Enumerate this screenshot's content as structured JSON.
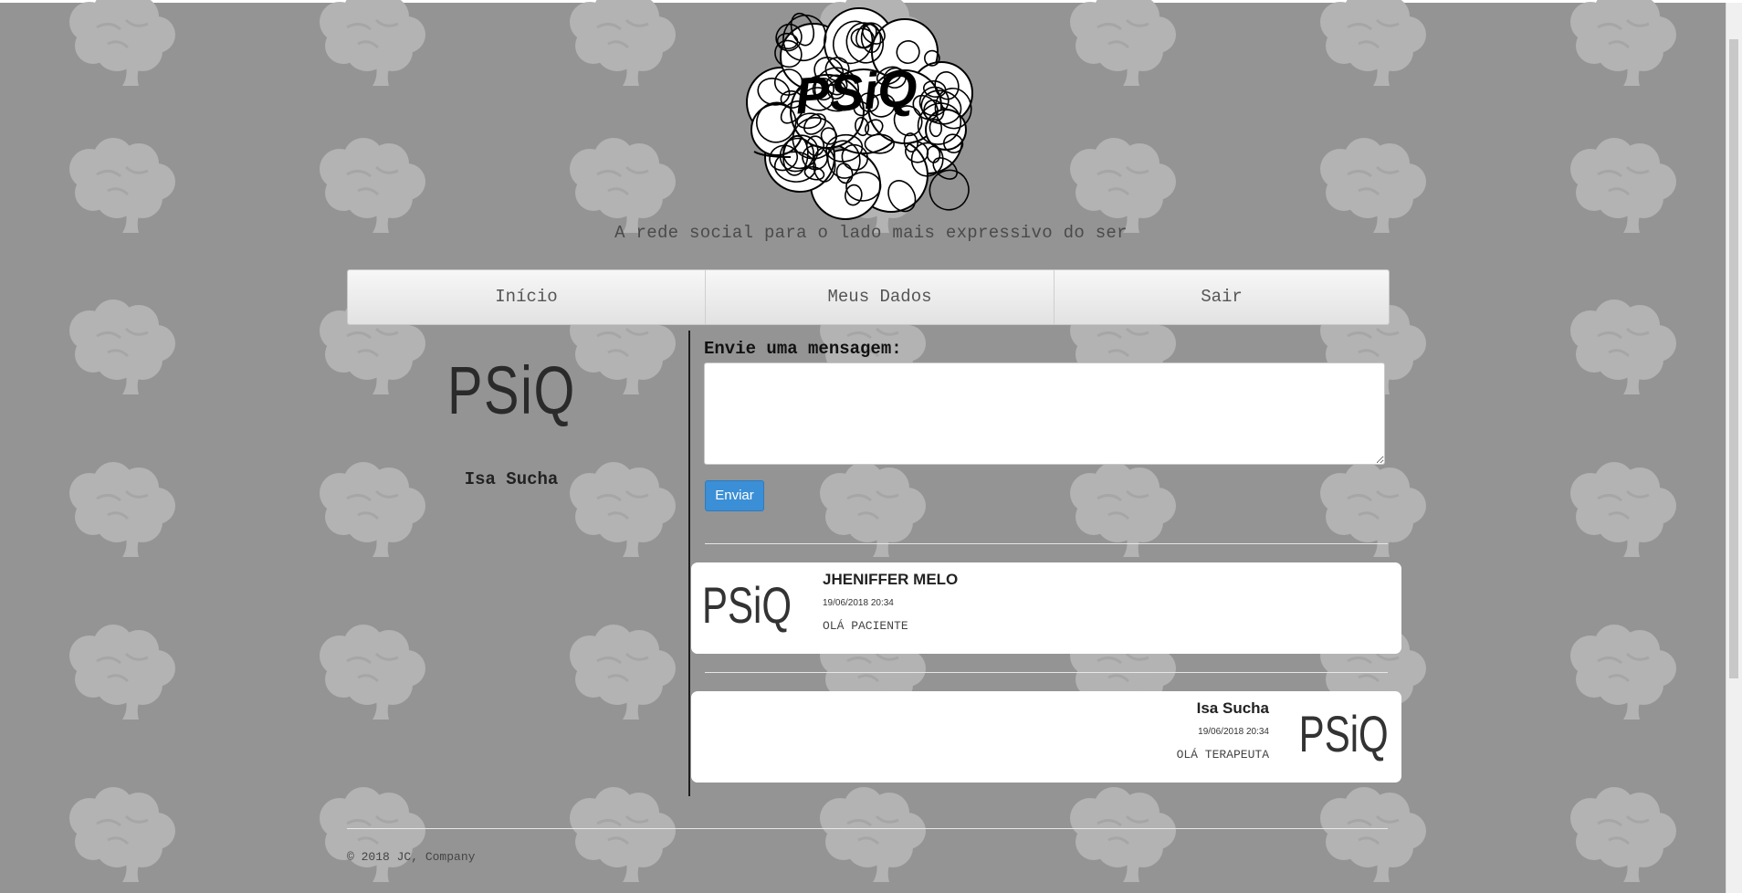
{
  "header": {
    "logo_text": "PSiQ",
    "tagline": "A rede social para o lado mais expressivo do ser"
  },
  "nav": {
    "items": [
      {
        "label": "Início"
      },
      {
        "label": "Meus Dados"
      },
      {
        "label": "Sair"
      }
    ]
  },
  "profile": {
    "logo_text": "PSiQ",
    "name": "Isa Sucha"
  },
  "compose": {
    "label": "Envie uma mensagem:",
    "textarea_value": "",
    "send_label": "Enviar"
  },
  "messages": [
    {
      "avatar_text": "PSiQ",
      "author": "JHENIFFER MELO",
      "date": "19/06/2018 20:34",
      "text": "OLÁ PACIENTE",
      "align": "left"
    },
    {
      "avatar_text": "PSiQ",
      "author": "Isa Sucha",
      "date": "19/06/2018 20:34",
      "text": "OLÁ TERAPEUTA",
      "align": "right"
    }
  ],
  "footer": {
    "copyright": "© 2018 JC, Company"
  },
  "colors": {
    "background": "#949494",
    "brain_pattern": "#b3b3b3",
    "accent_button": "#3a8fd6"
  }
}
